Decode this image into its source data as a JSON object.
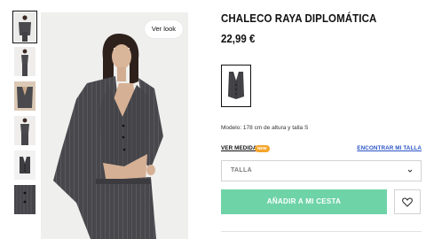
{
  "gallery": {
    "thumbnails": [
      {
        "name": "thumb-look-front",
        "active": true
      },
      {
        "name": "thumb-look-side",
        "active": false
      },
      {
        "name": "thumb-vest-closeup",
        "active": false
      },
      {
        "name": "thumb-look-full",
        "active": false
      },
      {
        "name": "thumb-vest-flat",
        "active": false
      },
      {
        "name": "thumb-fabric-detail",
        "active": false
      }
    ],
    "ver_look_label": "Ver look"
  },
  "product": {
    "title": "CHALECO RAYA DIPLOMÁTICA",
    "price": "22,99 €",
    "model_info": "Modelo: 178 cm de altura y talla S",
    "ver_medidas_label": "VER MEDIDAS",
    "new_badge": "NEW",
    "encontrar_talla_label": "ENCONTRAR MI TALLA",
    "size_placeholder": "TALLA",
    "add_to_cart_label": "AÑADIR A MI CESTA"
  },
  "colors": {
    "fabric": "#4a4a4e",
    "accent_button": "#6fd3a8",
    "link_blue": "#2c55c7",
    "badge_orange": "#f4a52b"
  },
  "icons": {
    "chevron": "chevron-down-icon",
    "favorite": "heart-icon"
  }
}
